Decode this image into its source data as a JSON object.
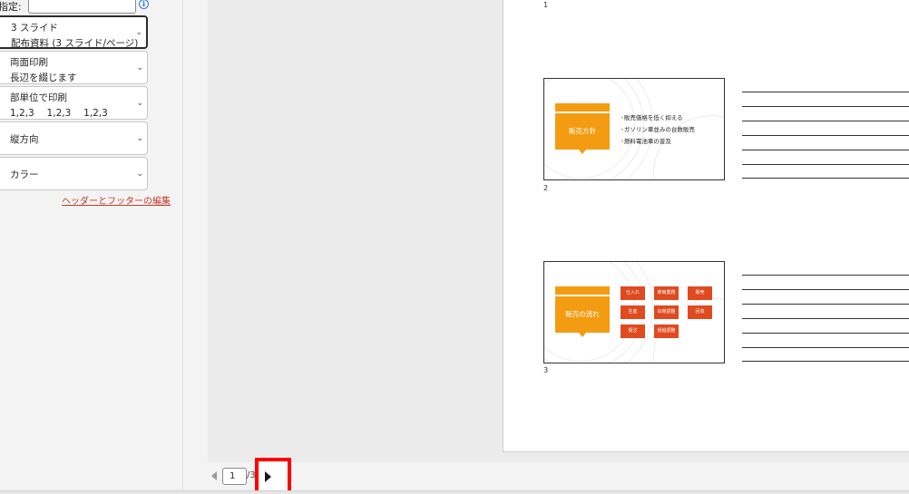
{
  "settings": {
    "slides_label": "指定:",
    "info_icon": "info-icon",
    "layout": {
      "line1": "3 スライド",
      "line2": "配布資料 (3 スライド/ページ)"
    },
    "sides": {
      "line1": "両面印刷",
      "line2": "長辺を綴じます"
    },
    "collation": {
      "line1": "部単位で印刷",
      "line2": "1,2,3　 1,2,3　 1,2,3"
    },
    "orientation": "縦方向",
    "color": "カラー",
    "header_footer_link": "ヘッダーとフッターの編集"
  },
  "preview": {
    "page_numbers": [
      "1",
      "2",
      "3"
    ],
    "slide2": {
      "title": "販売方針",
      "bullets": [
        "販売価格を低く抑える",
        "ガソリン車並みの台数販売",
        "燃料電池車の普及"
      ]
    },
    "slide3": {
      "title": "販売の流れ",
      "boxes": [
        "仕入れ",
        "車両業務",
        "販売",
        "生産",
        "出荷調整",
        "回収",
        "受注",
        "受給調整"
      ]
    }
  },
  "navigator": {
    "current_page": "1",
    "total_pages": "/3",
    "prev_icon": "chevron-left-icon",
    "next_icon": "chevron-right-icon",
    "highlight_color": "#ff0000"
  }
}
